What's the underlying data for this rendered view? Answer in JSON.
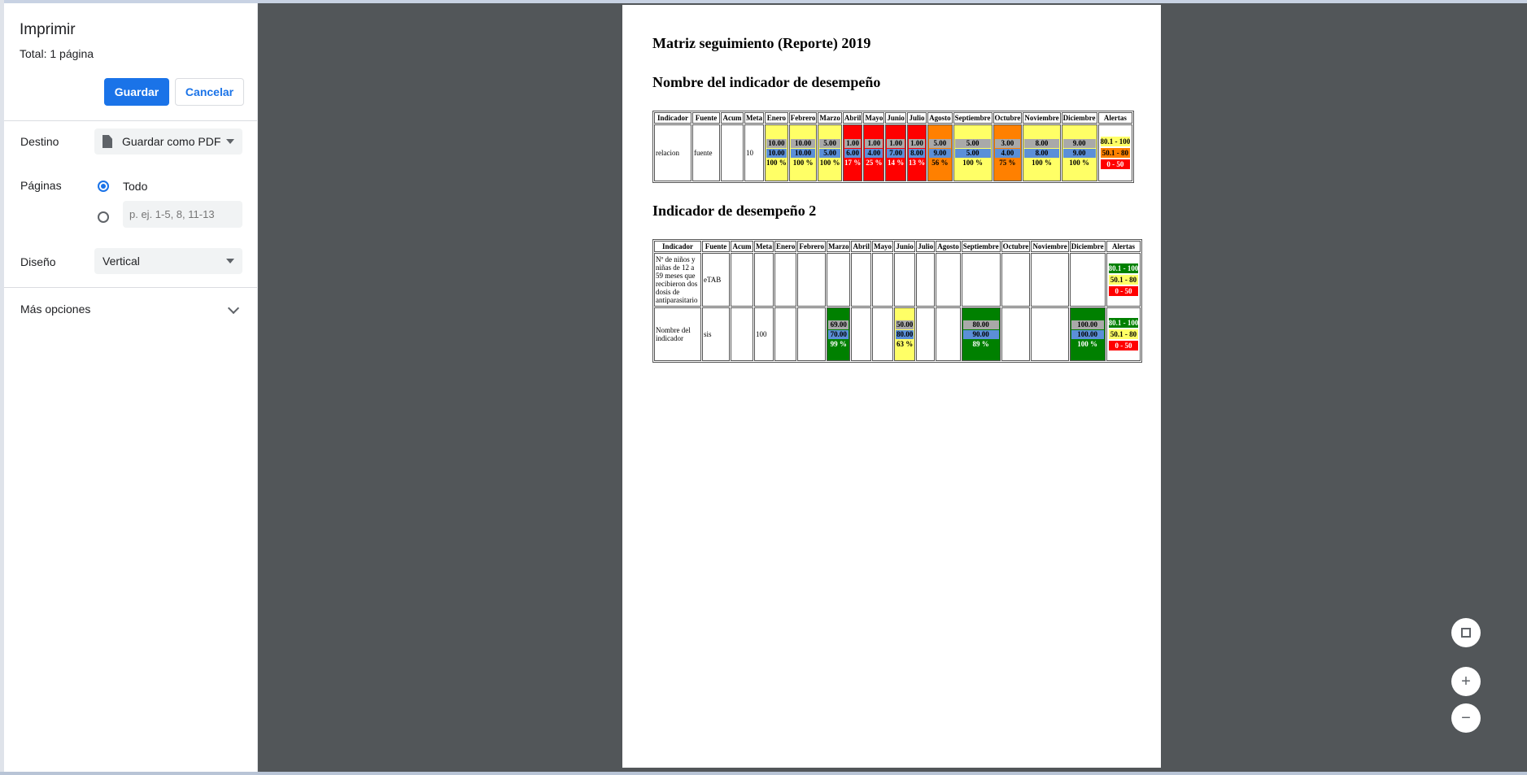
{
  "print_panel": {
    "title": "Imprimir",
    "total": "Total: 1 página",
    "save_label": "Guardar",
    "cancel_label": "Cancelar",
    "destination_label": "Destino",
    "destination_value": "Guardar como PDF",
    "pages_label": "Páginas",
    "pages_all_label": "Todo",
    "pages_placeholder": "p. ej. 1-5, 8, 11-13",
    "layout_label": "Diseño",
    "layout_value": "Vertical",
    "more_options_label": "Más opciones"
  },
  "document": {
    "title": "Matriz seguimiento (Reporte) 2019",
    "section1_title": "Nombre del indicador de desempeño",
    "section2_title": "Indicador de desempeño 2",
    "headers1": [
      "Indicador",
      "Fuente",
      "Acum",
      "Meta",
      "Enero",
      "Febrero",
      "Marzo",
      "Abril",
      "Mayo",
      "Junio",
      "Julio",
      "Agosto",
      "Septiembre",
      "Octubre",
      "Noviembre",
      "Diciembre",
      "Alertas"
    ],
    "headers2": [
      "Indicador",
      "Fuente",
      "Acum",
      "Meta",
      "Enero",
      "Febrero",
      "Marzo",
      "Abril",
      "Mayo",
      "Junio",
      "Julio",
      "Agosto",
      "Septiembre",
      "Octubre",
      "Noviembre",
      "Diciembre",
      "Alertas"
    ],
    "table1_row": {
      "indicador": "relacion",
      "fuente": "fuente",
      "acum": "",
      "meta": "10",
      "months": [
        {
          "a": "10.00",
          "b": "10.00",
          "pct": "100 %",
          "color": "yellow"
        },
        {
          "a": "10.00",
          "b": "10.00",
          "pct": "100 %",
          "color": "yellow"
        },
        {
          "a": "5.00",
          "b": "5.00",
          "pct": "100 %",
          "color": "yellow"
        },
        {
          "a": "1.00",
          "b": "6.00",
          "pct": "17 %",
          "color": "red"
        },
        {
          "a": "1.00",
          "b": "4.00",
          "pct": "25 %",
          "color": "red"
        },
        {
          "a": "1.00",
          "b": "7.00",
          "pct": "14 %",
          "color": "red"
        },
        {
          "a": "1.00",
          "b": "8.00",
          "pct": "13 %",
          "color": "red"
        },
        {
          "a": "5.00",
          "b": "9.00",
          "pct": "56 %",
          "color": "orange"
        },
        {
          "a": "5.00",
          "b": "5.00",
          "pct": "100 %",
          "color": "yellow"
        },
        {
          "a": "3.00",
          "b": "4.00",
          "pct": "75 %",
          "color": "orange"
        },
        {
          "a": "8.00",
          "b": "8.00",
          "pct": "100 %",
          "color": "yellow"
        },
        {
          "a": "9.00",
          "b": "9.00",
          "pct": "100 %",
          "color": "yellow"
        }
      ],
      "alerts": [
        "80.1 - 100",
        "50.1 - 80",
        "0 - 50"
      ]
    },
    "table2_rows": [
      {
        "indicador": "Nº de niños y niñas de 12 a 59 meses que recibieron dos dosis de antiparasitario",
        "fuente": "eTAB",
        "acum": "",
        "meta": "",
        "months": [
          null,
          null,
          null,
          null,
          null,
          null,
          null,
          null,
          null,
          null,
          null,
          null
        ],
        "alerts": [
          "80.1 - 100",
          "50.1 - 80",
          "0 - 50"
        ]
      },
      {
        "indicador": "Nombre del indicador",
        "fuente": "sis",
        "acum": "",
        "meta": "100",
        "months": [
          null,
          null,
          {
            "a": "69.00",
            "b": "70.00",
            "pct": "99 %",
            "color": "green"
          },
          null,
          null,
          {
            "a": "50.00",
            "b": "80.00",
            "pct": "63 %",
            "color": "yellow"
          },
          null,
          null,
          {
            "a": "80.00",
            "b": "90.00",
            "pct": "89 %",
            "color": "green"
          },
          null,
          null,
          {
            "a": "100.00",
            "b": "100.00",
            "pct": "100 %",
            "color": "green"
          }
        ],
        "alerts": [
          "80.1 - 100",
          "50.1 - 80",
          "0 - 50"
        ]
      }
    ]
  },
  "colors": {
    "accent": "#1a73e8",
    "preview_bg": "#525659",
    "yellow": "#ffff66",
    "red": "#ff0000",
    "orange": "#ff8000",
    "green": "#008000"
  },
  "controls": {
    "fullscreen_icon": "fullscreen-icon",
    "zoom_in_icon": "plus-icon",
    "zoom_out_icon": "minus-icon"
  }
}
